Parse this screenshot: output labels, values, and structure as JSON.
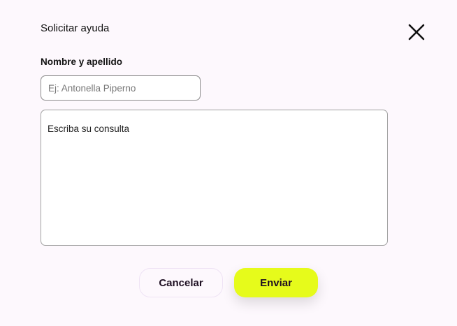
{
  "dialog": {
    "title": "Solicitar ayuda",
    "close_icon": "close-icon",
    "name_label": "Nombre y apellido",
    "name_placeholder": "Ej: Antonella Piperno",
    "name_value": "",
    "query_placeholder": "Escriba su consulta",
    "query_value": "",
    "cancel_label": "Cancelar",
    "send_label": "Enviar"
  },
  "colors": {
    "accent": "#e6fb1b",
    "background": "#fdf8fd",
    "text": "#1e0f22"
  }
}
